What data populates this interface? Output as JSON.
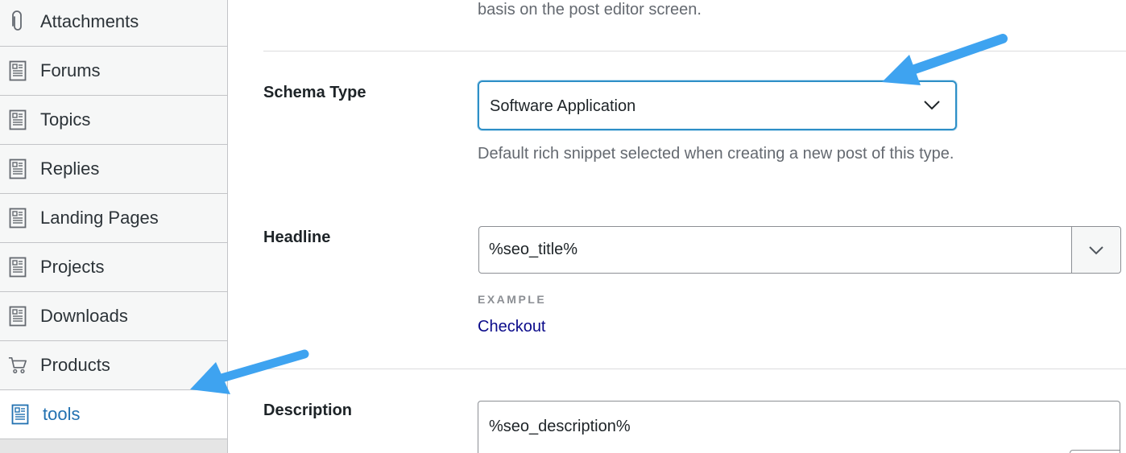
{
  "sidebar": {
    "items": [
      {
        "label": "Attachments",
        "icon": "paperclip-icon"
      },
      {
        "label": "Forums",
        "icon": "page-icon"
      },
      {
        "label": "Topics",
        "icon": "page-icon"
      },
      {
        "label": "Replies",
        "icon": "page-icon"
      },
      {
        "label": "Landing Pages",
        "icon": "page-icon"
      },
      {
        "label": "Projects",
        "icon": "page-icon"
      },
      {
        "label": "Downloads",
        "icon": "page-icon"
      },
      {
        "label": "Products",
        "icon": "cart-icon"
      },
      {
        "label": "tools",
        "icon": "page-icon",
        "active": true
      }
    ]
  },
  "main": {
    "top_description": "basis on the post editor screen.",
    "schema_type": {
      "label": "Schema Type",
      "value": "Software Application",
      "help": "Default rich snippet selected when creating a new post of this type."
    },
    "headline": {
      "label": "Headline",
      "value": "%seo_title%",
      "example_label": "EXAMPLE",
      "example_value": "Checkout"
    },
    "description": {
      "label": "Description",
      "value": "%seo_description%"
    }
  },
  "colors": {
    "accent": "#2271b1",
    "arrow": "#3ea3f0",
    "focus_border": "#2e8fc7",
    "link": "#0a0a8a"
  }
}
